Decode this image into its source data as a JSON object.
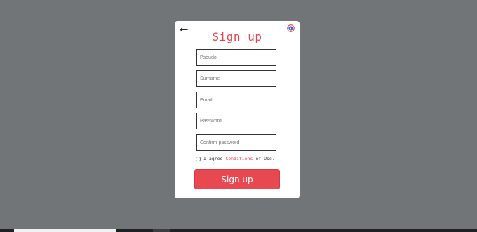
{
  "form": {
    "title": "Sign up",
    "back_icon": "arrow-left-icon",
    "info_icon": "info-icon",
    "fields": {
      "pseudo": {
        "placeholder": "Pseudo",
        "value": ""
      },
      "surname": {
        "placeholder": "Surname",
        "value": ""
      },
      "email": {
        "placeholder": "Email",
        "value": ""
      },
      "password": {
        "placeholder": "Password",
        "value": ""
      },
      "confirm_password": {
        "placeholder": "Confirm password",
        "value": ""
      }
    },
    "agree": {
      "checked": false,
      "prefix": "I agree ",
      "link": "Conditions",
      "suffix": " of Use."
    },
    "submit_label": "Sign up"
  },
  "colors": {
    "backdrop": "#727578",
    "accent": "#e3414d",
    "button": "#e8484f"
  }
}
